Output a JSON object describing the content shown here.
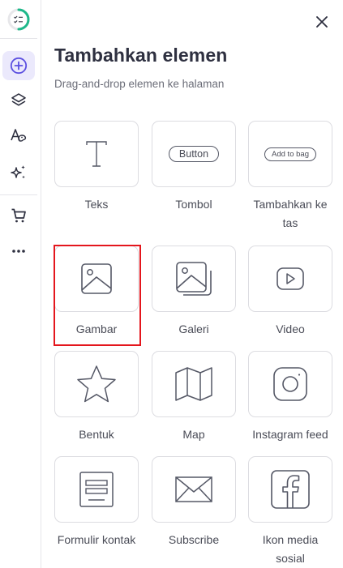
{
  "sidebar": {
    "items": [
      {
        "id": "checklist",
        "icon": "checklist-progress-icon"
      },
      {
        "id": "add-element",
        "icon": "plus-circle-icon",
        "active": true
      },
      {
        "id": "layers",
        "icon": "layers-icon"
      },
      {
        "id": "theme",
        "icon": "palette-icon"
      },
      {
        "id": "ai",
        "icon": "sparkle-icon"
      },
      {
        "id": "store",
        "icon": "cart-icon"
      },
      {
        "id": "more",
        "icon": "more-icon"
      }
    ],
    "colors": {
      "accent": "#5b4fe0",
      "active_bg": "#ebe9fc",
      "progress": "#1fb88a"
    }
  },
  "panel": {
    "title": "Tambahkan elemen",
    "subtitle": "Drag-and-drop elemen ke halaman",
    "close_icon": "close-icon"
  },
  "elements": [
    {
      "label": "Teks",
      "icon": "text-icon"
    },
    {
      "label": "Tombol",
      "icon": "button-icon",
      "preview_text": "Button"
    },
    {
      "label": "Tambahkan ke tas",
      "icon": "add-to-bag-icon",
      "preview_text": "Add to bag"
    },
    {
      "label": "Gambar",
      "icon": "image-icon",
      "selected": true
    },
    {
      "label": "Galeri",
      "icon": "gallery-icon"
    },
    {
      "label": "Video",
      "icon": "video-icon"
    },
    {
      "label": "Bentuk",
      "icon": "star-icon"
    },
    {
      "label": "Map",
      "icon": "map-icon"
    },
    {
      "label": "Instagram feed",
      "icon": "instagram-icon"
    },
    {
      "label": "Formulir kontak",
      "icon": "form-icon"
    },
    {
      "label": "Subscribe",
      "icon": "envelope-icon"
    },
    {
      "label": "Ikon media sosial",
      "icon": "facebook-icon"
    }
  ],
  "highlight_color": "#e4161d"
}
